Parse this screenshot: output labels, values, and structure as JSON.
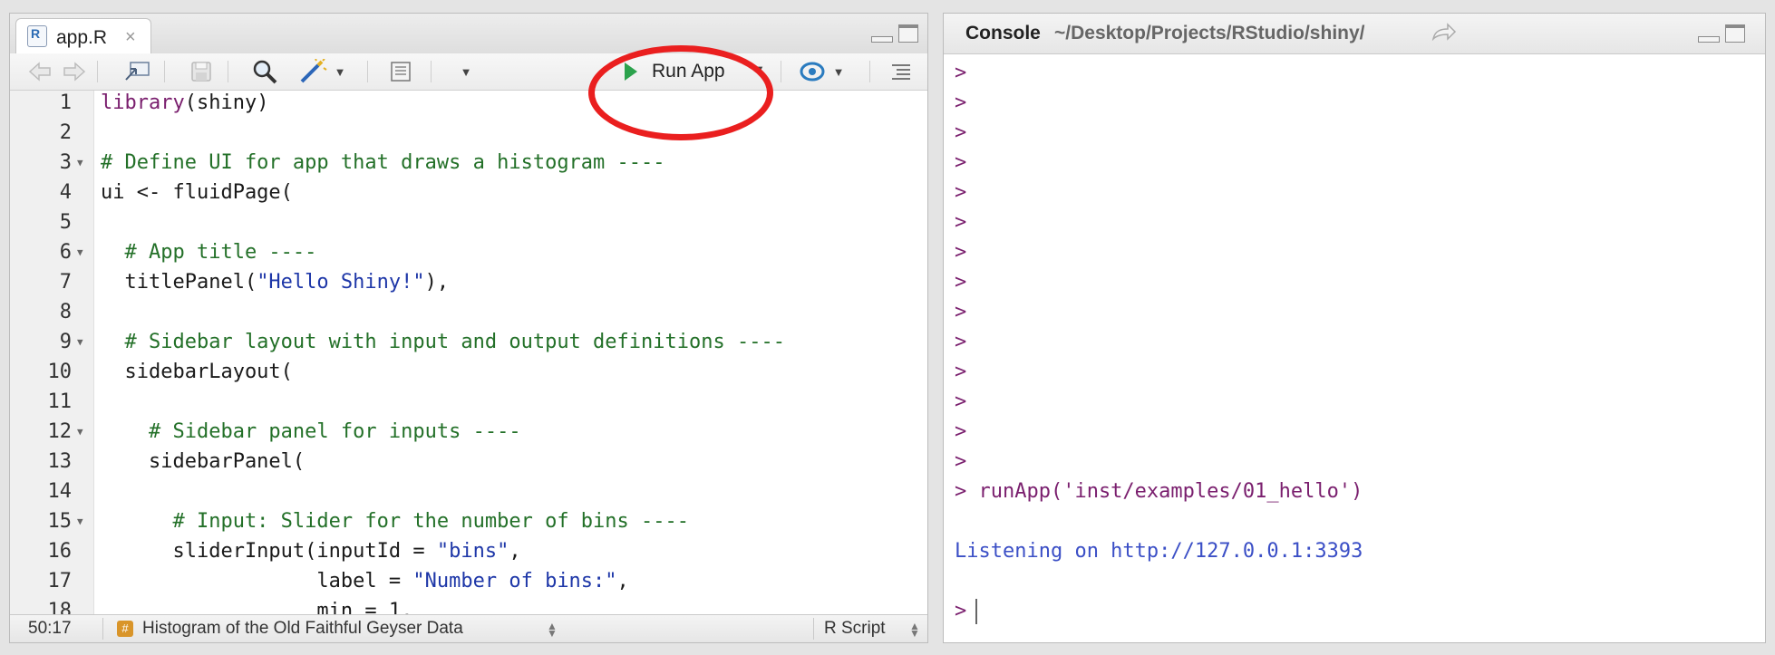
{
  "editor": {
    "tab_label": "app.R",
    "tab_close": "×",
    "file_icon_letter": "R",
    "run_app_label": "Run App",
    "lines": [
      {
        "n": "1",
        "fold": false,
        "parts": [
          {
            "t": "library",
            "c": "fn"
          },
          {
            "t": "(shiny)",
            "c": ""
          }
        ]
      },
      {
        "n": "2",
        "fold": false,
        "parts": []
      },
      {
        "n": "3",
        "fold": true,
        "parts": [
          {
            "t": "# Define UI for app that draws a histogram ----",
            "c": "cm"
          }
        ]
      },
      {
        "n": "4",
        "fold": false,
        "parts": [
          {
            "t": "ui <- fluidPage(",
            "c": ""
          }
        ]
      },
      {
        "n": "5",
        "fold": false,
        "parts": []
      },
      {
        "n": "6",
        "fold": true,
        "parts": [
          {
            "t": "  # App title ----",
            "c": "cm"
          }
        ]
      },
      {
        "n": "7",
        "fold": false,
        "parts": [
          {
            "t": "  titlePanel(",
            "c": ""
          },
          {
            "t": "\"Hello Shiny!\"",
            "c": "str"
          },
          {
            "t": "),",
            "c": ""
          }
        ]
      },
      {
        "n": "8",
        "fold": false,
        "parts": []
      },
      {
        "n": "9",
        "fold": true,
        "parts": [
          {
            "t": "  # Sidebar layout with input and output definitions ----",
            "c": "cm"
          }
        ]
      },
      {
        "n": "10",
        "fold": false,
        "parts": [
          {
            "t": "  sidebarLayout(",
            "c": ""
          }
        ]
      },
      {
        "n": "11",
        "fold": false,
        "parts": []
      },
      {
        "n": "12",
        "fold": true,
        "parts": [
          {
            "t": "    # Sidebar panel for inputs ----",
            "c": "cm"
          }
        ]
      },
      {
        "n": "13",
        "fold": false,
        "parts": [
          {
            "t": "    sidebarPanel(",
            "c": ""
          }
        ]
      },
      {
        "n": "14",
        "fold": false,
        "parts": []
      },
      {
        "n": "15",
        "fold": true,
        "parts": [
          {
            "t": "      # Input: Slider for the number of bins ----",
            "c": "cm"
          }
        ]
      },
      {
        "n": "16",
        "fold": false,
        "parts": [
          {
            "t": "      sliderInput(inputId = ",
            "c": ""
          },
          {
            "t": "\"bins\"",
            "c": "str"
          },
          {
            "t": ",",
            "c": ""
          }
        ]
      },
      {
        "n": "17",
        "fold": false,
        "parts": [
          {
            "t": "                  label = ",
            "c": ""
          },
          {
            "t": "\"Number of bins:\"",
            "c": "str"
          },
          {
            "t": ",",
            "c": ""
          }
        ]
      },
      {
        "n": "18",
        "fold": false,
        "parts": [
          {
            "t": "                  min = 1,",
            "c": ""
          }
        ]
      }
    ]
  },
  "status": {
    "position": "50:17",
    "function_name": "Histogram of the Old Faithful Geyser Data",
    "file_type": "R Script",
    "badge": "#"
  },
  "console": {
    "title": "Console",
    "path": "~/Desktop/Projects/RStudio/shiny/",
    "lines": [
      {
        "text": ">",
        "c": "prompt"
      },
      {
        "text": ">",
        "c": "prompt"
      },
      {
        "text": ">",
        "c": "prompt"
      },
      {
        "text": ">",
        "c": "prompt"
      },
      {
        "text": ">",
        "c": "prompt"
      },
      {
        "text": ">",
        "c": "prompt"
      },
      {
        "text": ">",
        "c": "prompt"
      },
      {
        "text": ">",
        "c": "prompt"
      },
      {
        "text": ">",
        "c": "prompt"
      },
      {
        "text": ">",
        "c": "prompt"
      },
      {
        "text": ">",
        "c": "prompt"
      },
      {
        "text": ">",
        "c": "prompt"
      },
      {
        "text": ">",
        "c": "prompt"
      },
      {
        "text": ">",
        "c": "prompt"
      },
      {
        "text": "> runApp('inst/examples/01_hello')",
        "c": "prompt"
      },
      {
        "text": "",
        "c": ""
      },
      {
        "text": "Listening on http://127.0.0.1:3393",
        "c": "blue"
      },
      {
        "text": "",
        "c": ""
      },
      {
        "text": ">",
        "c": "prompt",
        "cursor": true
      }
    ]
  }
}
